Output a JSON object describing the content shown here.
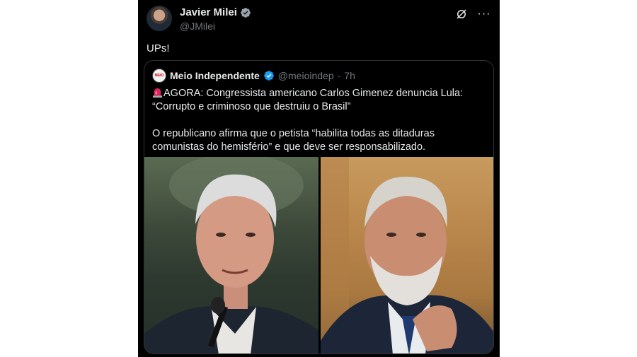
{
  "tweet": {
    "author_name": "Javier Milei",
    "author_handle": "@JMilei",
    "text": "UPs!",
    "icons": {
      "verified": "verified-badge-icon",
      "grok": "grok-icon",
      "more": "more-options-icon"
    },
    "more_label": "···",
    "colors": {
      "background": "#000000",
      "text": "#e7e9ea",
      "muted": "#71767b",
      "verified": "#1d9bf0"
    }
  },
  "quote": {
    "author_name": "Meio Independente",
    "author_handle": "@meioindep",
    "separator": "·",
    "time": "7h",
    "avatar_text": "MEIO",
    "alarm_icon": "rotating-light-emoji",
    "line1": "AGORA: Congressista americano Carlos Gimenez denuncia Lula: “Corrupto e criminoso que destruiu o Brasil”",
    "line2": "O republicano afirma que o petista “habilita todas as ditaduras comunistas do hemisfério” e que deve ser responsabilizado.",
    "photos": [
      "photo-gimenez",
      "photo-lula"
    ]
  }
}
